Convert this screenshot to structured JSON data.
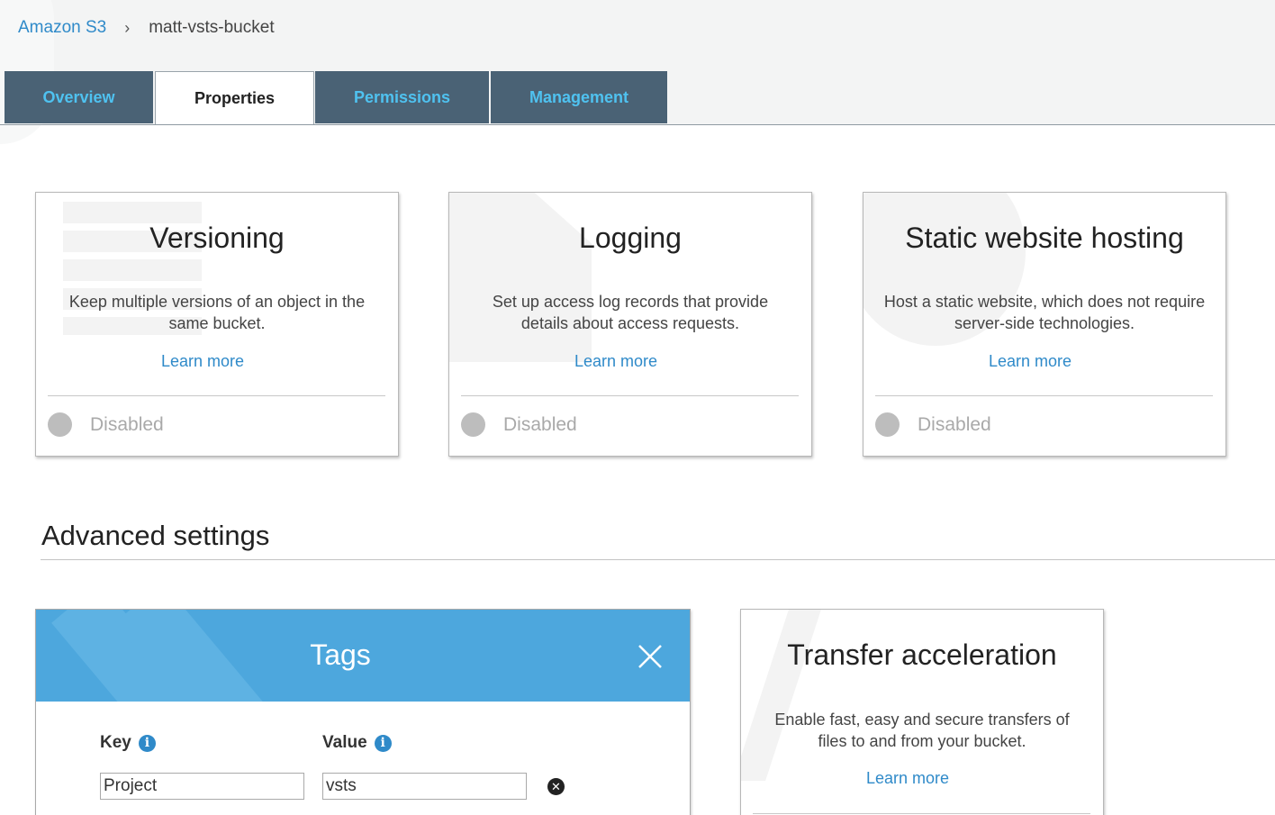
{
  "breadcrumb": {
    "root": "Amazon S3",
    "separator": "›",
    "current": "matt-vsts-bucket"
  },
  "tabs": [
    {
      "label": "Overview",
      "active": false
    },
    {
      "label": "Properties",
      "active": true
    },
    {
      "label": "Permissions",
      "active": false
    },
    {
      "label": "Management",
      "active": false
    }
  ],
  "cards": [
    {
      "title": "Versioning",
      "description": "Keep multiple versions of an object in the same bucket.",
      "link": "Learn more",
      "status": "Disabled",
      "icon": "versioning-icon"
    },
    {
      "title": "Logging",
      "description": "Set up access log records that provide details about access requests.",
      "link": "Learn more",
      "status": "Disabled",
      "icon": "document-icon"
    },
    {
      "title": "Static website hosting",
      "description": "Host a static website, which does not require server-side technologies.",
      "link": "Learn more",
      "status": "Disabled",
      "icon": "globe-icon"
    }
  ],
  "advanced": {
    "title": "Advanced settings",
    "tags": {
      "title": "Tags",
      "key_label": "Key",
      "value_label": "Value",
      "row": {
        "key": "Project",
        "value": "vsts"
      }
    },
    "transfer": {
      "title": "Transfer acceleration",
      "description": "Enable fast, easy and secure transfers of files to and from your bucket.",
      "link": "Learn more",
      "icon": "lightning-icon"
    }
  },
  "colors": {
    "tab_bg": "#4a6275",
    "tab_text": "#4fc2f0",
    "link": "#2f8ac9",
    "tags_header": "#4da7dd",
    "status_dot": "#bdbdbd"
  }
}
